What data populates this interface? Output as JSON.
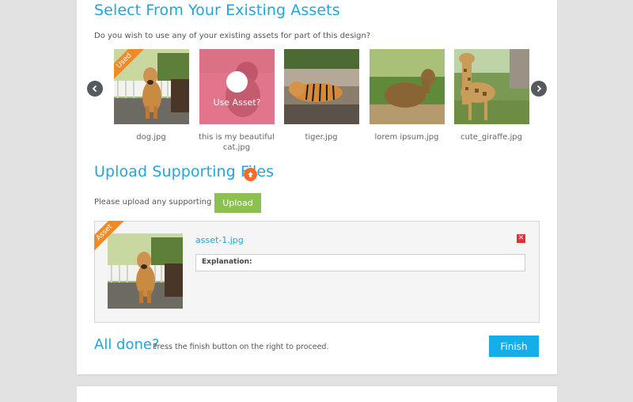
{
  "section_assets": {
    "title": "Select From Your Existing Assets",
    "prompt": "Do you wish to use any of your existing assets for part of this design?",
    "items": [
      {
        "caption": "dog.jpg",
        "badge": "Used"
      },
      {
        "caption": "this is my beautiful cat.jpg",
        "overlay": "Use Asset?"
      },
      {
        "caption": "tiger.jpg"
      },
      {
        "caption": "lorem ipsum.jpg"
      },
      {
        "caption": "cute_giraffe.jpg"
      }
    ],
    "prev_icon": "chevron-left-icon",
    "next_icon": "chevron-right-icon"
  },
  "section_upload": {
    "title": "Upload Supporting Files",
    "prompt": "Please upload any supporting files",
    "upload_label": "Upload",
    "title_icon": "upload-arrow-icon"
  },
  "uploaded_asset": {
    "badge": "Asset",
    "filename": "asset-1.jpg",
    "explanation_label": "Explanation:",
    "remove_icon": "close-icon"
  },
  "footer": {
    "heading": "All done?",
    "text": "Press the finish button on the right to proceed.",
    "finish_label": "Finish"
  },
  "colors": {
    "accent": "#21a6dc",
    "ribbon": "#f08a24",
    "upload_button": "#8cc152",
    "finish_button": "#16aee8",
    "remove": "#e03232"
  }
}
